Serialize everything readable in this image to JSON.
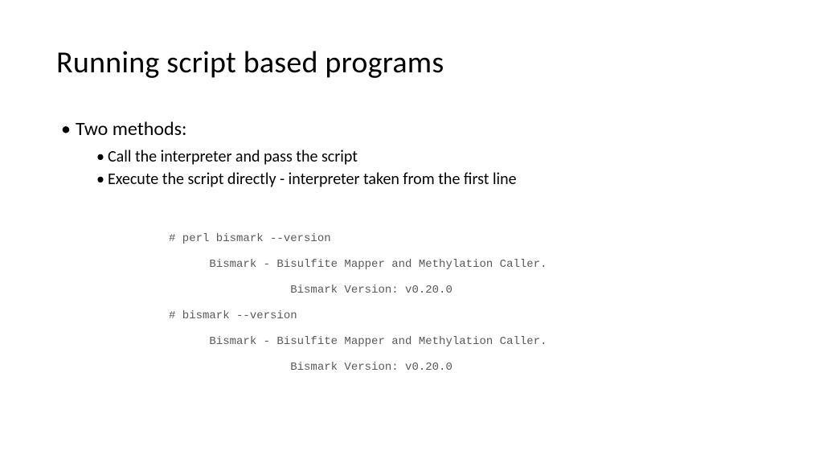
{
  "title": "Running script based programs",
  "bullets": {
    "l1": "Two methods:",
    "l2a": "Call the interpreter and pass the script",
    "l2b": "Execute the script directly - interpreter taken from the first line"
  },
  "code": {
    "line1": "# perl bismark --version",
    "line2": "      Bismark - Bisulfite Mapper and Methylation Caller.",
    "line3": "                  Bismark Version: v0.20.0",
    "line4": "# bismark --version",
    "line5": "      Bismark - Bisulfite Mapper and Methylation Caller.",
    "line6": "                  Bismark Version: v0.20.0"
  }
}
